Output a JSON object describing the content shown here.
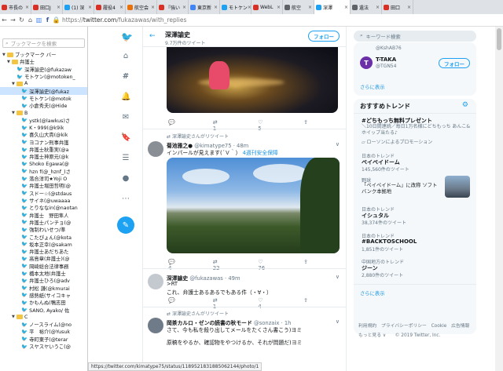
{
  "tabs": [
    {
      "label": "市長の",
      "color": "#d93025"
    },
    {
      "label": "田口J",
      "color": "#d93025"
    },
    {
      "label": "(1) 深",
      "color": "#1da1f2"
    },
    {
      "label": "履役4",
      "color": "#d93025"
    },
    {
      "label": "航空会",
      "color": "#e8710a"
    },
    {
      "label": "『強い",
      "color": "#d93025"
    },
    {
      "label": "東京新",
      "color": "#4285f4"
    },
    {
      "label": "モトケン",
      "color": "#1da1f2"
    },
    {
      "label": "WebL",
      "color": "#d93025"
    },
    {
      "label": "航空",
      "color": "#5f6368"
    },
    {
      "label": "深澤",
      "color": "#1da1f2"
    },
    {
      "label": "遺法",
      "color": "#5f6368"
    },
    {
      "label": "田口",
      "color": "#d93025"
    }
  ],
  "address": {
    "scheme": "https://",
    "host": "twitter.com",
    "path": "/fukazawas/with_replies"
  },
  "bookmarks": {
    "search_placeholder": "ブックマークを検索",
    "rows": [
      {
        "t": "ブックマーク バー",
        "k": "folder",
        "d": 0,
        "o": "▼"
      },
      {
        "t": "弁護士",
        "k": "folder",
        "d": 1,
        "o": "▼"
      },
      {
        "t": "深澤諭史(@fukazaw",
        "k": "tw",
        "d": 2
      },
      {
        "t": "モトケン(@motoken_",
        "k": "tw",
        "d": 2
      },
      {
        "t": "A",
        "k": "folder",
        "d": 2,
        "o": "▼"
      },
      {
        "t": "深澤諭史(@fukaz",
        "k": "tw",
        "d": 3,
        "sel": true
      },
      {
        "t": "モトケン(@motok",
        "k": "tw",
        "d": 3
      },
      {
        "t": "小倉秀夫(@Hide",
        "k": "tw",
        "d": 3
      },
      {
        "t": "B",
        "k": "folder",
        "d": 2,
        "o": "▼"
      },
      {
        "t": "ystk(@lawkus)さ",
        "k": "tw",
        "d": 3
      },
      {
        "t": "K・999(@k9ik",
        "k": "tw",
        "d": 3
      },
      {
        "t": "喜久山大貴(@kik",
        "k": "tw",
        "d": 3
      },
      {
        "t": "ヨコナン刑事弁護",
        "k": "tw",
        "d": 3
      },
      {
        "t": "弁護士秋重実(@a",
        "k": "tw",
        "d": 3
      },
      {
        "t": "弁護士神原元(@k",
        "k": "tw",
        "d": 3
      },
      {
        "t": "Shoko Egawa(@",
        "k": "tw",
        "d": 3
      },
      {
        "t": "hzn f(@_hznf_)さ",
        "k": "tw",
        "d": 3
      },
      {
        "t": "落合洋司★Yoji O",
        "k": "tw",
        "d": 3
      },
      {
        "t": "弁護士堀田哲明(@",
        "k": "tw",
        "d": 3
      },
      {
        "t": "スドー☆(@stdaus",
        "k": "tw",
        "d": 3
      },
      {
        "t": "サイネ(@uwaaaa",
        "k": "tw",
        "d": 3
      },
      {
        "t": "とりななin(@naotan",
        "k": "tw",
        "d": 3
      },
      {
        "t": "弁護士　野田隼人",
        "k": "tw",
        "d": 3
      },
      {
        "t": "弁護士パンチョ(@",
        "k": "tw",
        "d": 3
      },
      {
        "t": "強制わいせつ/準",
        "k": "tw",
        "d": 3
      },
      {
        "t": "こたぴょん(@kota",
        "k": "tw",
        "d": 3
      },
      {
        "t": "坂本正幸(@sakam",
        "k": "tw",
        "d": 3
      },
      {
        "t": "弁護士あだちあた",
        "k": "tw",
        "d": 3
      },
      {
        "t": "高島章(弁護士)(@",
        "k": "tw",
        "d": 3
      },
      {
        "t": "岡崎総合法律事務",
        "k": "tw",
        "d": 3
      },
      {
        "t": "橋本太地(弁護士",
        "k": "tw",
        "d": 3
      },
      {
        "t": "弁護士ひろ(@adv",
        "k": "tw",
        "d": 3
      },
      {
        "t": "村松 謙(@kmurai",
        "k": "tw",
        "d": 3
      },
      {
        "t": "感熱紙(サイコキャ",
        "k": "tw",
        "d": 3
      },
      {
        "t": "かもんぬ(鴨志田",
        "k": "tw",
        "d": 3
      },
      {
        "t": "SANO, Ayako/ 佐",
        "k": "tw",
        "d": 3
      },
      {
        "t": "C",
        "k": "folder",
        "d": 2,
        "o": "▼"
      },
      {
        "t": "ノースライム(@no",
        "k": "tw",
        "d": 3
      },
      {
        "t": "平　裕介(@Yusuk",
        "k": "tw",
        "d": 3
      },
      {
        "t": "寺町東子(@terar",
        "k": "tw",
        "d": 3
      },
      {
        "t": "スヤスヤいうこ(@",
        "k": "tw",
        "d": 3
      }
    ]
  },
  "profile": {
    "name": "深澤諭史",
    "count": "9.7万件のツイート",
    "follow_label": "フォロー"
  },
  "tweet1": {
    "reply": "",
    "rt": "1",
    "like": "5"
  },
  "tweet2": {
    "rt_label": "深澤諭史さんがリツイート",
    "name": "菊池雅之●",
    "handle": "@kimatype75 · 48m",
    "text": "インパールが見えます(´Ｖ｀）",
    "link": "4週刊安全保障",
    "reply": "4",
    "rt": "22",
    "like": "76"
  },
  "tweet3": {
    "name": "深澤諭史",
    "handle": "@fukazawas · 49m",
    "line1": ">RT",
    "line2": "これ、弁護士あるあるでもある件（・∀・）",
    "reply": "",
    "rt": "1",
    "like": "4"
  },
  "tweet4": {
    "rt_label": "深澤諭史さんがリツイート",
    "name": "岡茶カルロ・ゼンの読書の秋モード",
    "handle": "@sonzaix · 1h",
    "line1": "さて、今も私を殺り出してメールをたくさん書こう)ヨミ",
    "line2": "原稿をやるか、確認物をやつけるか、それが問題だ)ヨミ"
  },
  "right": {
    "search_placeholder": "キーワード検索",
    "acct1_handle": "@KshAB76",
    "acct2_name": "T-TAKA",
    "acct2_handle": "@TGN54",
    "follow_label": "フォロー",
    "more": "さらに表示",
    "trends_title": "おすすめトレンド",
    "promo_title": "#どちもっち無料プレゼント",
    "promo_text": "＼10日間連続／毎日1万名様にどちもっち あんこ&ホイップ当たる♪",
    "promo_by": "ローソンによるプロモーション",
    "t1_cat": "日本のトレンド",
    "t1_name": "ペイペイドーム",
    "t1_count": "145,560件のツイート",
    "news_cat": "野球",
    "news_text": "「ペイペイドーム」に改称 ソフトバンク本拠地",
    "t2_cat": "日本のトレンド",
    "t2_name": "イシュタル",
    "t2_count": "38,374件のツイート",
    "t3_cat": "日本のトレンド",
    "t3_name": "#BACKTOSCHOOL",
    "t3_count": "1,851件のツイート",
    "t4_cat": "中国地方のトレンド",
    "t4_name": "ジーン",
    "t4_count": "2,880件のツイート",
    "more2": "さらに表示",
    "footer1": "利用規約　プライバシーポリシー　Cookie　広告情報",
    "footer2": "もっと見る ∨　　© 2019 Twitter, Inc."
  },
  "status_url": "https://twitter.com/kimatype75/status/1189521831885062144/photo/1"
}
